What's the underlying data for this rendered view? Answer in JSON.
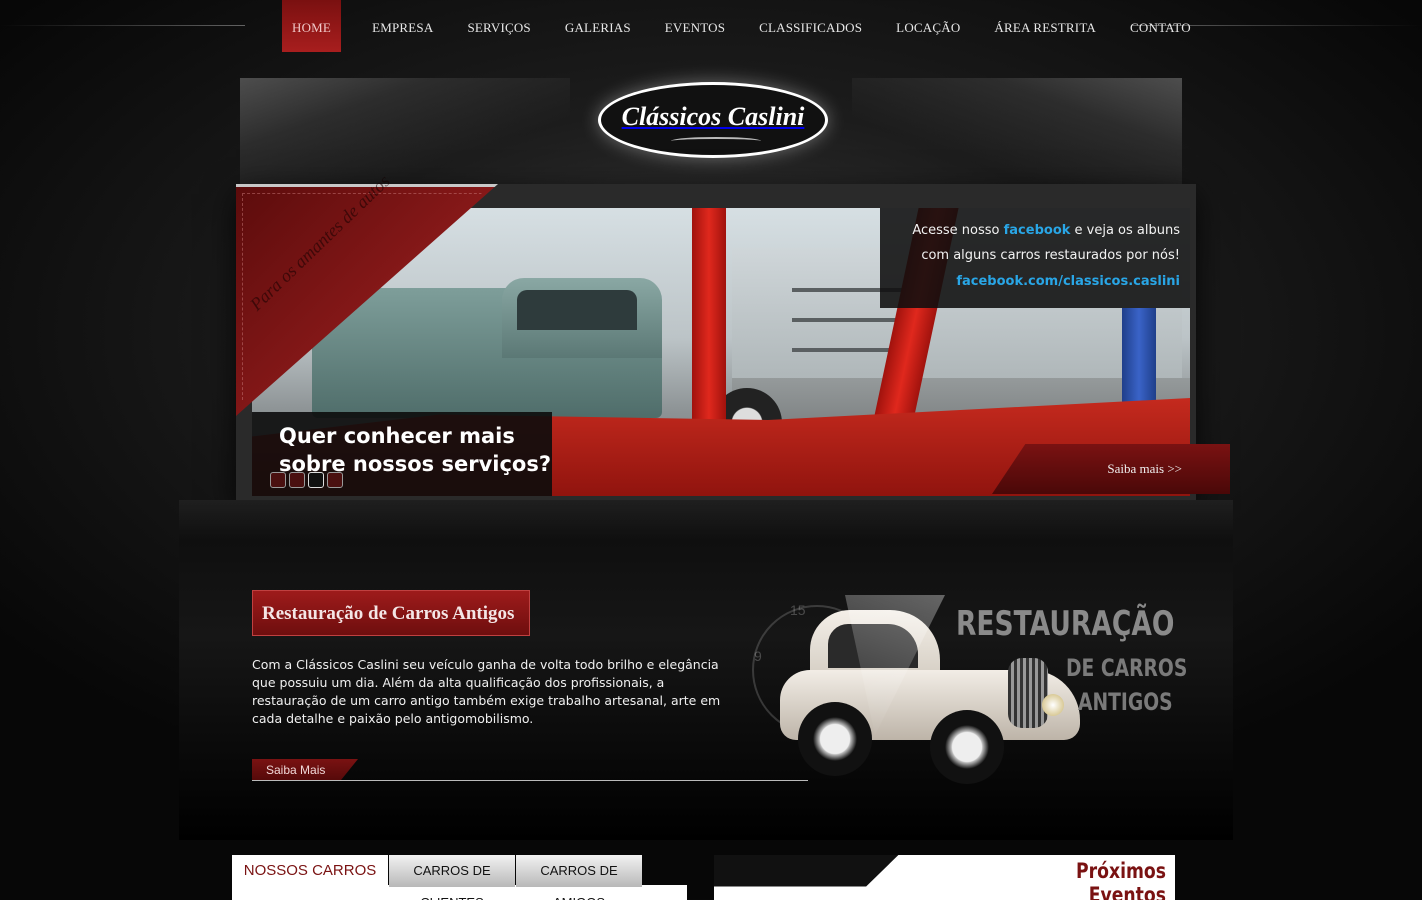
{
  "nav": {
    "items": [
      {
        "label": "HOME",
        "active": true
      },
      {
        "label": "EMPRESA"
      },
      {
        "label": "SERVIÇOS"
      },
      {
        "label": "GALERIAS"
      },
      {
        "label": "EVENTOS"
      },
      {
        "label": "CLASSIFICADOS"
      },
      {
        "label": "LOCAÇÃO"
      },
      {
        "label": "ÁREA RESTRITA"
      },
      {
        "label": "CONTATO"
      }
    ]
  },
  "logo": {
    "text": "Clássicos Caslini"
  },
  "slider": {
    "ribbon_text": "Para os amantes de autos",
    "facebook_box": {
      "line1_pre": "Acesse nosso ",
      "line1_bold": "facebook",
      "line1_post": " e veja os albuns",
      "line2": "com alguns carros restaurados por nós!",
      "link": "facebook.com/classicos.caslini"
    },
    "caption_line1": "Quer conhecer mais",
    "caption_line2": "sobre nossos serviços?",
    "dots_count": 4,
    "active_dot": 3,
    "saiba_label": "Saiba mais >>"
  },
  "section": {
    "title": "Restauração de Carros Antigos",
    "text": "Com a Clássicos Caslini seu veículo ganha de volta todo brilho e elegância que possuiu um dia. Além da alta qualificação dos profissionais, a restauração de um carro antigo também exige trabalho artesanal, arte em cada detalhe e paixão pelo antigomobilismo.",
    "button": "Saiba Mais"
  },
  "art": {
    "line1": "RESTAURAÇÃO",
    "line2": "DE CARROS",
    "line3": "ANTIGOS",
    "gauge_numbers": [
      "15",
      "9"
    ]
  },
  "tabs": [
    {
      "label": "NOSSOS CARROS",
      "active": true
    },
    {
      "label": "CARROS DE CLIENTES"
    },
    {
      "label": "CARROS DE AMIGOS"
    }
  ],
  "events": {
    "title": "Próximos Eventos"
  },
  "colors": {
    "accent": "#8c1a1a",
    "link": "#29a6e6"
  }
}
